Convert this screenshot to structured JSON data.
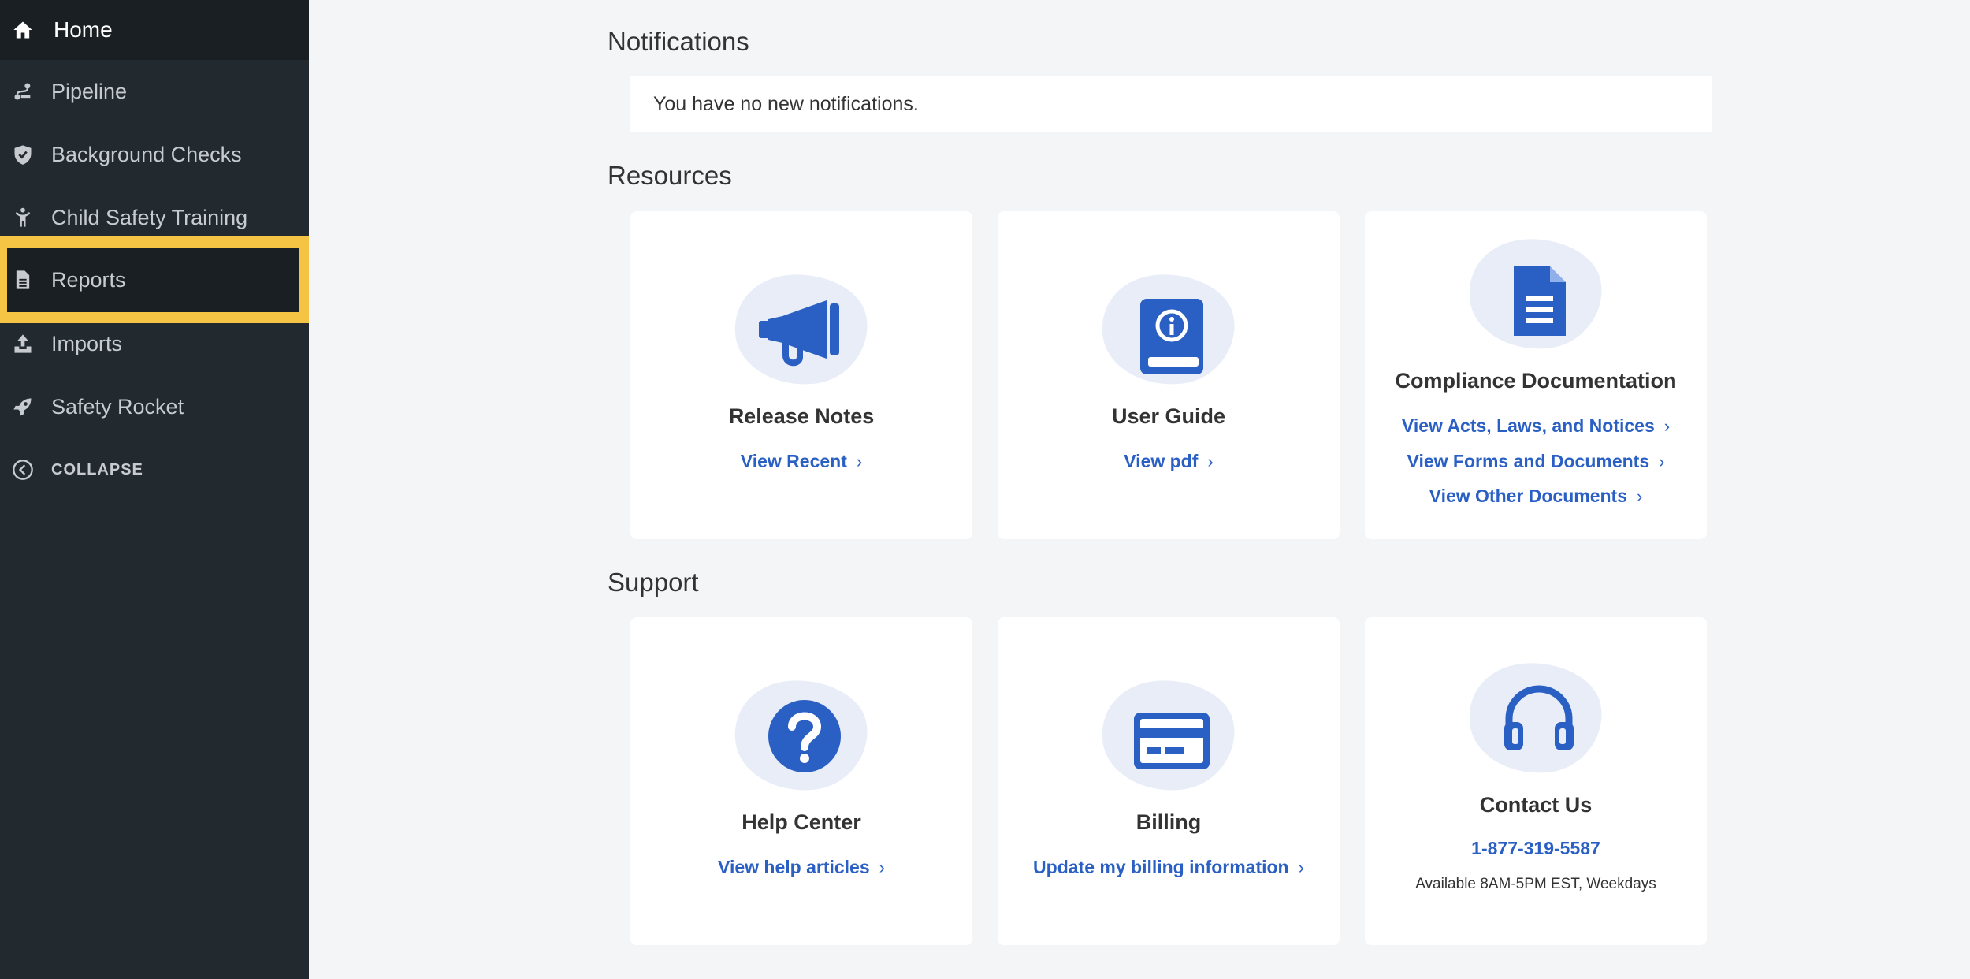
{
  "sidebar": {
    "items": [
      {
        "label": "Home",
        "icon": "home-icon"
      },
      {
        "label": "Pipeline",
        "icon": "pipeline-icon"
      },
      {
        "label": "Background Checks",
        "icon": "shield-icon"
      },
      {
        "label": "Child Safety Training",
        "icon": "child-icon"
      },
      {
        "label": "Reports",
        "icon": "document-icon"
      },
      {
        "label": "Imports",
        "icon": "upload-icon"
      },
      {
        "label": "Safety Rocket",
        "icon": "rocket-icon"
      }
    ],
    "collapse_label": "COLLAPSE"
  },
  "notifications": {
    "title": "Notifications",
    "message": "You have no new notifications."
  },
  "resources": {
    "title": "Resources",
    "cards": [
      {
        "title": "Release Notes",
        "links": [
          "View Recent"
        ],
        "icon": "megaphone-icon"
      },
      {
        "title": "User Guide",
        "links": [
          "View pdf"
        ],
        "icon": "info-book-icon"
      },
      {
        "title": "Compliance Documentation",
        "links": [
          "View Acts, Laws, and Notices",
          "View Forms and Documents",
          "View Other Documents"
        ],
        "icon": "file-icon"
      }
    ]
  },
  "support": {
    "title": "Support",
    "cards": [
      {
        "title": "Help Center",
        "links": [
          "View help articles"
        ],
        "icon": "question-icon"
      },
      {
        "title": "Billing",
        "links": [
          "Update my billing information"
        ],
        "icon": "credit-card-icon"
      },
      {
        "title": "Contact Us",
        "phone": "1-877-319-5587",
        "note": "Available 8AM-5PM EST, Weekdays",
        "icon": "headset-icon"
      }
    ]
  },
  "colors": {
    "sidebar_bg": "#222a30",
    "highlight": "#f6c445",
    "accent": "#2a5fc4",
    "icon_blob": "#e8edf8"
  }
}
